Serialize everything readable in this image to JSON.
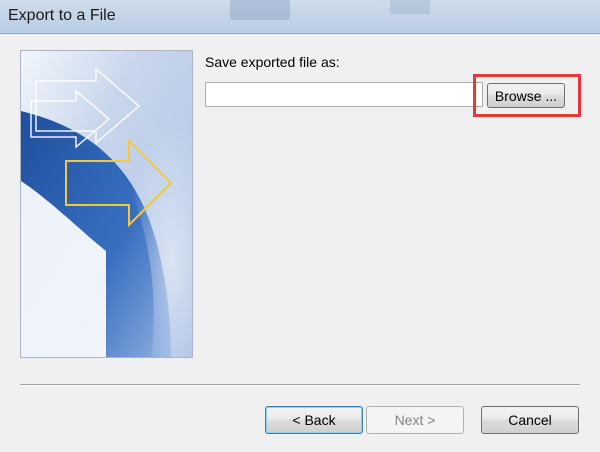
{
  "window": {
    "title": "Export to a File"
  },
  "form": {
    "label": "Save exported file as:",
    "path_value": "",
    "browse_label": "Browse ..."
  },
  "buttons": {
    "back_label": "< Back",
    "next_label": "Next >",
    "cancel_label": "Cancel",
    "next_enabled": false
  },
  "colors": {
    "highlight": "#e53935",
    "art_blue": "#2a5caa",
    "art_arrow": "#f2c744"
  },
  "icons": {
    "side_art": "export-wizard-art"
  }
}
